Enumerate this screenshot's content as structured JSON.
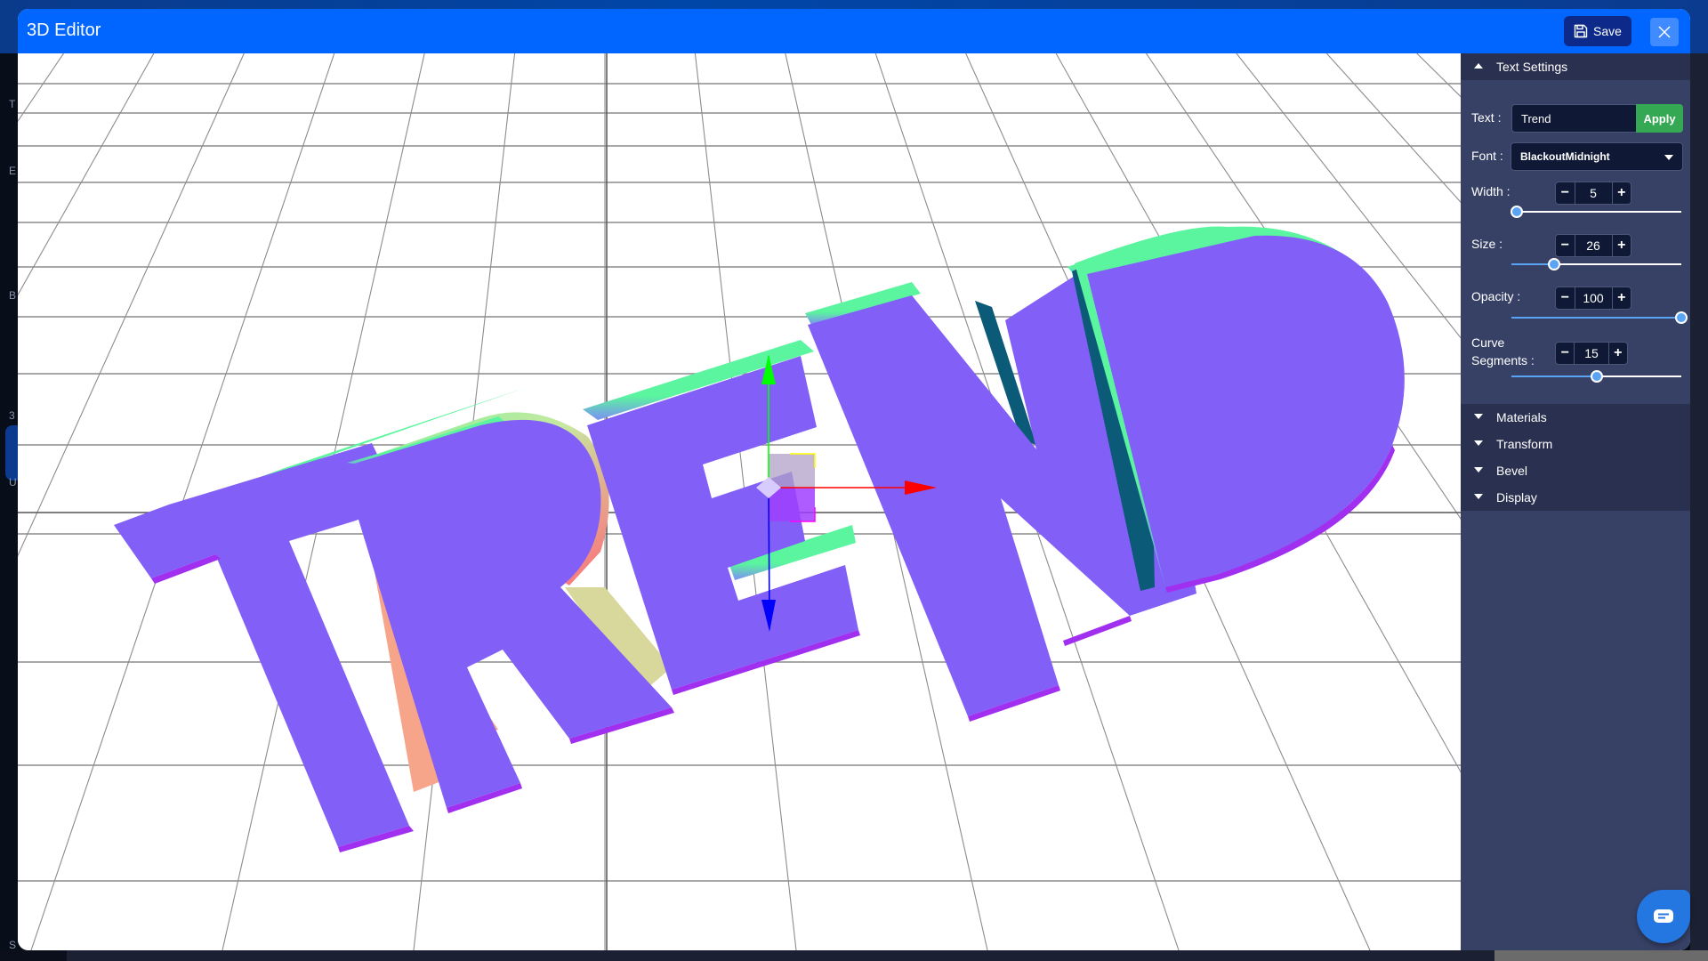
{
  "window": {
    "title": "3D Editor",
    "save_label": "Save",
    "save_icon": "floppy-disk-icon",
    "close_icon": "close-x-icon"
  },
  "background_app": {
    "sidebar_initials": [
      "T",
      "E",
      "B",
      "3",
      "U",
      "S"
    ]
  },
  "viewport": {
    "scene_text": "TREND",
    "gizmo": {
      "axes": [
        {
          "name": "x",
          "color": "#ff0000"
        },
        {
          "name": "y",
          "color": "#00ff00"
        },
        {
          "name": "z",
          "color": "#0000ff"
        }
      ]
    },
    "colors": {
      "face": "#825ff7",
      "top_bevel": "#5af59e",
      "side_right": "#f7a58a",
      "side_dark": "#0b5b78",
      "side_yellow": "#d8d89c",
      "bottom_edge": "#a02ff0",
      "grid": "#8c8c8c"
    }
  },
  "panel": {
    "text_settings": {
      "title": "Text Settings",
      "text_label": "Text :",
      "text_value": "Trend",
      "apply_label": "Apply",
      "font_label": "Font :",
      "font_value": "BlackoutMidnight",
      "width": {
        "label": "Width :",
        "value": "5",
        "fraction": 0.03
      },
      "size": {
        "label": "Size :",
        "value": "26",
        "fraction": 0.25
      },
      "opacity": {
        "label": "Opacity :",
        "value": "100",
        "fraction": 1.0
      },
      "curve_segments": {
        "label_line1": "Curve",
        "label_line2": "Segments :",
        "value": "15",
        "fraction": 0.5
      },
      "minus": "−",
      "plus": "+"
    },
    "sections": [
      {
        "label": "Materials"
      },
      {
        "label": "Transform"
      },
      {
        "label": "Bevel"
      },
      {
        "label": "Display"
      }
    ]
  },
  "chat_widget": {
    "icon": "chat-bubble-icon"
  }
}
